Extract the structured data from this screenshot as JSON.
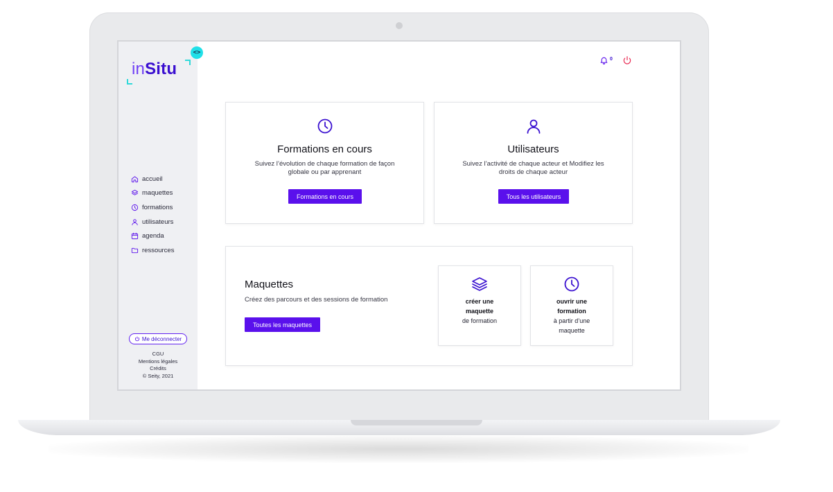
{
  "app": {
    "logo_in": "in",
    "logo_situ": "Situ",
    "collapse_symbol": "<>",
    "accent": "#5a10ec",
    "teal": "#20e0e8"
  },
  "sidebar": {
    "items": [
      {
        "label": "accueil",
        "icon": "home-icon"
      },
      {
        "label": "maquettes",
        "icon": "layers-icon"
      },
      {
        "label": "formations",
        "icon": "clock-icon"
      },
      {
        "label": "utilisateurs",
        "icon": "user-icon"
      },
      {
        "label": "agenda",
        "icon": "calendar-icon"
      },
      {
        "label": "ressources",
        "icon": "folder-icon"
      }
    ],
    "logout_label": "Me déconnecter",
    "footer": {
      "cgu": "CGU",
      "mentions": "Mentions légales",
      "credits": "Crédits",
      "copyright": "© Seity, 2021"
    }
  },
  "header": {
    "notifications_count": "0"
  },
  "cards": {
    "formations": {
      "title": "Formations en cours",
      "description": "Suivez l’évolution de chaque formation de façon globale ou par apprenant",
      "button": "Formations en cours"
    },
    "utilisateurs": {
      "title": "Utilisateurs",
      "description": "Suivez l’activité de chaque acteur et Modifiez les droits de chaque acteur",
      "button": "Tous les utilisateurs"
    },
    "maquettes": {
      "title": "Maquettes",
      "description": "Créez des parcours et des sessions de formation",
      "button": "Toutes les maquettes",
      "create": {
        "bold1": "créer une",
        "bold2": "maquette",
        "normal": "de formation"
      },
      "open": {
        "bold1": "ouvrir une",
        "bold2": "formation",
        "normal1": "à partir d’une",
        "normal2": "maquette"
      }
    }
  }
}
